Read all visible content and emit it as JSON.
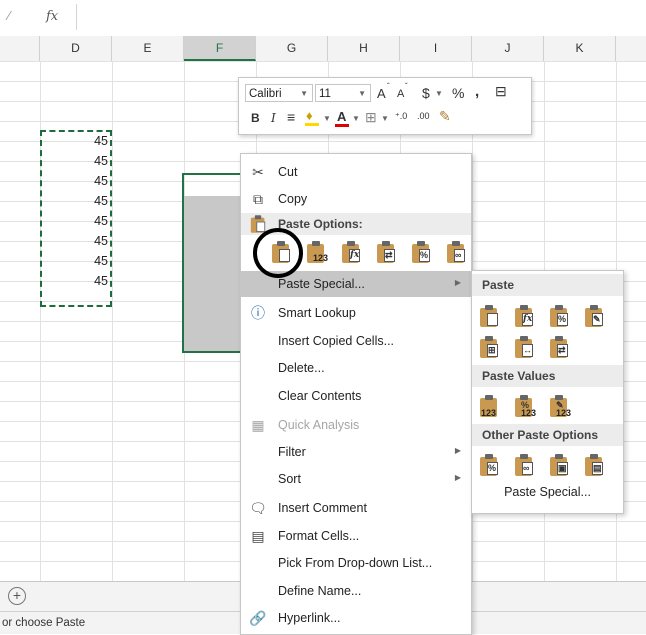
{
  "formula_bar": {
    "fx_label": "fx"
  },
  "columns": [
    "D",
    "E",
    "F",
    "G",
    "H",
    "I",
    "J",
    "K"
  ],
  "cells": {
    "values": [
      "45",
      "45",
      "45",
      "45",
      "45",
      "45",
      "45",
      "45"
    ]
  },
  "mini_toolbar": {
    "font_name": "Calibri",
    "font_size": "11",
    "grow_font": "A",
    "shrink_font": "A",
    "currency": "$",
    "percent": "%",
    "comma": ",",
    "bold": "B",
    "italic": "I",
    "font_color": "A"
  },
  "context_menu": {
    "cut": "Cut",
    "copy": "Copy",
    "paste_options_header": "Paste Options:",
    "paste_special": "Paste Special...",
    "smart_lookup": "Smart Lookup",
    "insert_copied_cells": "Insert Copied Cells...",
    "delete": "Delete...",
    "clear_contents": "Clear Contents",
    "quick_analysis": "Quick Analysis",
    "filter": "Filter",
    "sort": "Sort",
    "insert_comment": "Insert Comment",
    "format_cells": "Format Cells...",
    "pick_from_list": "Pick From Drop-down List...",
    "define_name": "Define Name...",
    "hyperlink": "Hyperlink..."
  },
  "submenu": {
    "paste_header": "Paste",
    "paste_values_header": "Paste Values",
    "other_paste_header": "Other Paste Options",
    "paste_special": "Paste Special..."
  },
  "status_bar": {
    "text": "or choose Paste"
  },
  "icons": {
    "cut": "scissors-icon",
    "copy": "copy-icon",
    "smart_lookup": "info-search-icon",
    "quick_analysis": "quick-analysis-icon",
    "insert_comment": "comment-icon",
    "format_cells": "format-cells-icon",
    "hyperlink": "link-icon",
    "add_sheet": "plus-circle-icon"
  },
  "colors": {
    "accent": "#217346",
    "marquee": "#1e6b3c",
    "clipboard": "#c99952"
  }
}
